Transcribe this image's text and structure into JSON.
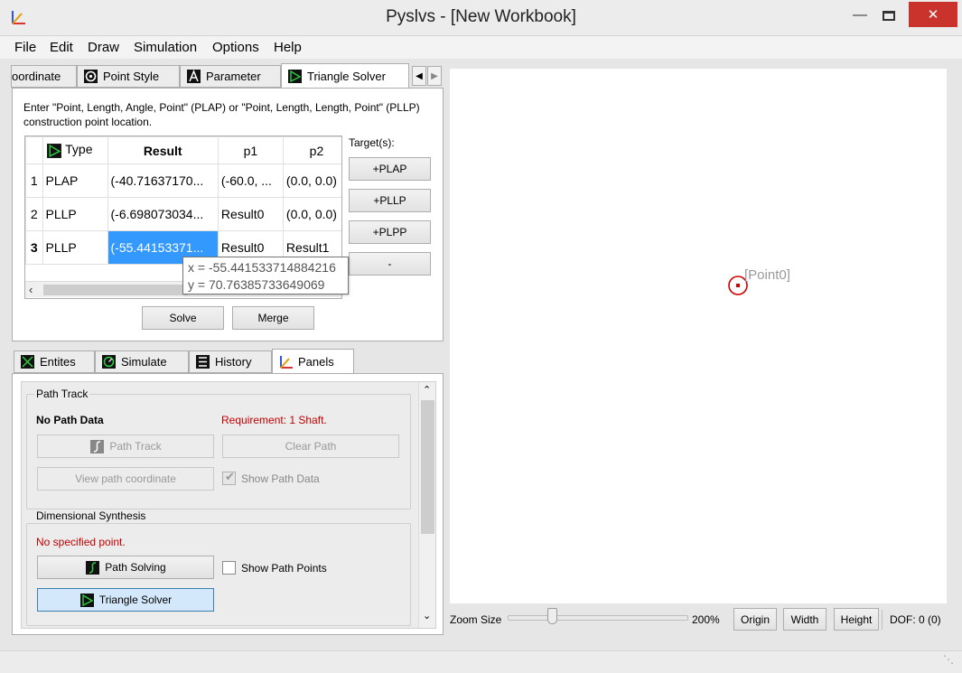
{
  "window": {
    "title": "Pyslvs - [New Workbook]"
  },
  "menu": [
    "File",
    "Edit",
    "Draw",
    "Simulation",
    "Options",
    "Help"
  ],
  "top_tabs": [
    {
      "label": "oordinate",
      "icon": "coordinate-icon"
    },
    {
      "label": "Point Style",
      "icon": "point-style-icon"
    },
    {
      "label": "Parameter",
      "icon": "parameter-icon"
    },
    {
      "label": "Triangle Solver",
      "icon": "triangle-solver-icon",
      "active": true
    }
  ],
  "solver": {
    "instructions": "Enter \"Point, Length, Angle, Point\" (PLAP) or \"Point, Length, Length, Point\" (PLLP) construction point location.",
    "columns": [
      "Type",
      "Result",
      "p1",
      "p2"
    ],
    "rows": [
      {
        "n": "1",
        "type": "PLAP",
        "result": "(-40.71637170...",
        "p1": "(-60.0, ...",
        "p2": "(0.0, 0.0)"
      },
      {
        "n": "2",
        "type": "PLLP",
        "result": "(-6.698073034...",
        "p1": "Result0",
        "p2": "(0.0, 0.0)"
      },
      {
        "n": "3",
        "type": "PLLP",
        "result": "(-55.44153371...",
        "p1": "Result0",
        "p2": "Result1"
      }
    ],
    "tooltip": {
      "x": "x = -55.441533714884216",
      "y": "y = 70.76385733649069"
    },
    "targets_label": "Target(s):",
    "target_buttons": [
      "+PLAP",
      "+PLLP",
      "+PLPP",
      "-"
    ],
    "solve": "Solve",
    "merge": "Merge"
  },
  "bottom_tabs": [
    {
      "label": "Entites",
      "icon": "entities-icon"
    },
    {
      "label": "Simulate",
      "icon": "simulate-icon"
    },
    {
      "label": "History",
      "icon": "history-icon"
    },
    {
      "label": "Panels",
      "icon": "panels-icon",
      "active": true
    }
  ],
  "path_track": {
    "title": "Path Track",
    "no_data": "No Path Data",
    "requirement": "Requirement: 1 Shaft.",
    "path_track_btn": "Path Track",
    "clear_path_btn": "Clear Path",
    "view_coord_btn": "View path coordinate",
    "show_path_data": "Show Path Data"
  },
  "dim_synth": {
    "title": "Dimensional Synthesis",
    "no_point": "No specified point.",
    "path_solving_btn": "Path Solving",
    "show_path_points": "Show Path Points",
    "triangle_solver_btn": "Triangle Solver"
  },
  "canvas": {
    "point_label": "[Point0]"
  },
  "statusbar": {
    "zoom_label": "Zoom Size",
    "zoom_value": "200%",
    "origin": "Origin",
    "width": "Width",
    "height": "Height",
    "dof": "DOF: 0 (0)"
  },
  "colors": {
    "accent": "#3399ff",
    "close": "#c9332b",
    "warning": "#c00000",
    "point": "#cc0000"
  }
}
